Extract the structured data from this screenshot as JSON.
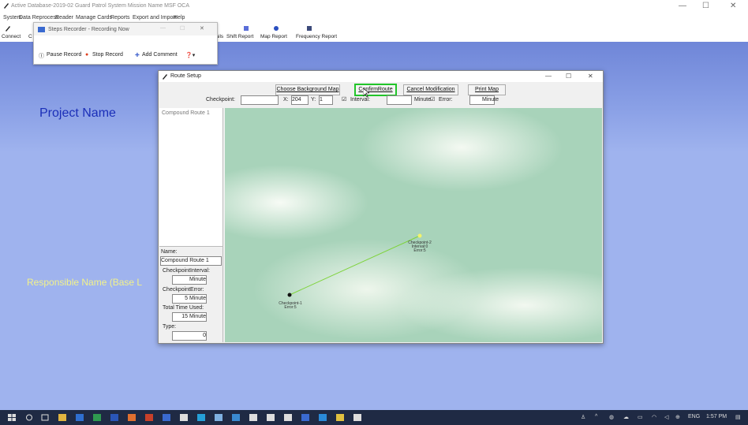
{
  "app": {
    "title": "Active Database-2019-02  Guard Patrol System Mission Name   MSF OCA",
    "menu": [
      "System",
      "Data Reprocess",
      "Reader",
      "Manage Cards",
      "Reports",
      "Export and Import",
      "Help"
    ],
    "toolbar": [
      "Connect",
      "C",
      "etails",
      "Shift Report",
      "Map Report",
      "Frequency Report"
    ]
  },
  "steps_recorder": {
    "title": "Steps Recorder - Recording Now",
    "pause": "Pause Record",
    "stop": "Stop Record",
    "add_comment": "Add Comment"
  },
  "workspace": {
    "project_name": "Project Name",
    "responsible_name": "Responsible Name (Base L"
  },
  "route_setup": {
    "title": "Route Setup",
    "buttons": {
      "choose_bg": "Choose Background Map",
      "confirm": "ConfirmRoute",
      "cancel": "Cancel Modification",
      "print": "Print Map"
    },
    "checkpoint_label": "Checkpoint:",
    "checkpoint_value": "",
    "x_label": "X:",
    "x_value": "204",
    "y_label": "Y:",
    "y_value": "1",
    "interval_label": "Interval:",
    "interval_value": "",
    "minute1": "Minute",
    "error_label": "Error:",
    "error_value": "",
    "minute2": "Minute",
    "tree_item": "Compound Route 1",
    "name_label": "Name:",
    "name_value": "Compound Route 1",
    "cp_interval_label": "CheckpointInterval:",
    "cp_interval_unit": "Minute",
    "cp_error_label": "CheckpointError:",
    "cp_error_value": "5 Minute",
    "total_label": "Total Time Used:",
    "total_value": "15 Minute",
    "type_label": "Type:",
    "type_value": "0",
    "checkpoints": [
      {
        "name": "Checkpoint-1",
        "detail": "Error:5"
      },
      {
        "name": "Checkpoint-2",
        "detail1": "Interval:0",
        "detail2": "Error:5"
      }
    ]
  },
  "taskbar": {
    "lang": "ENG",
    "time": "1:57 PM"
  },
  "colors": {
    "workspace": "#9fb3ee",
    "route_line": "#7ed33a",
    "confirm_highlight": "#22c52a"
  }
}
